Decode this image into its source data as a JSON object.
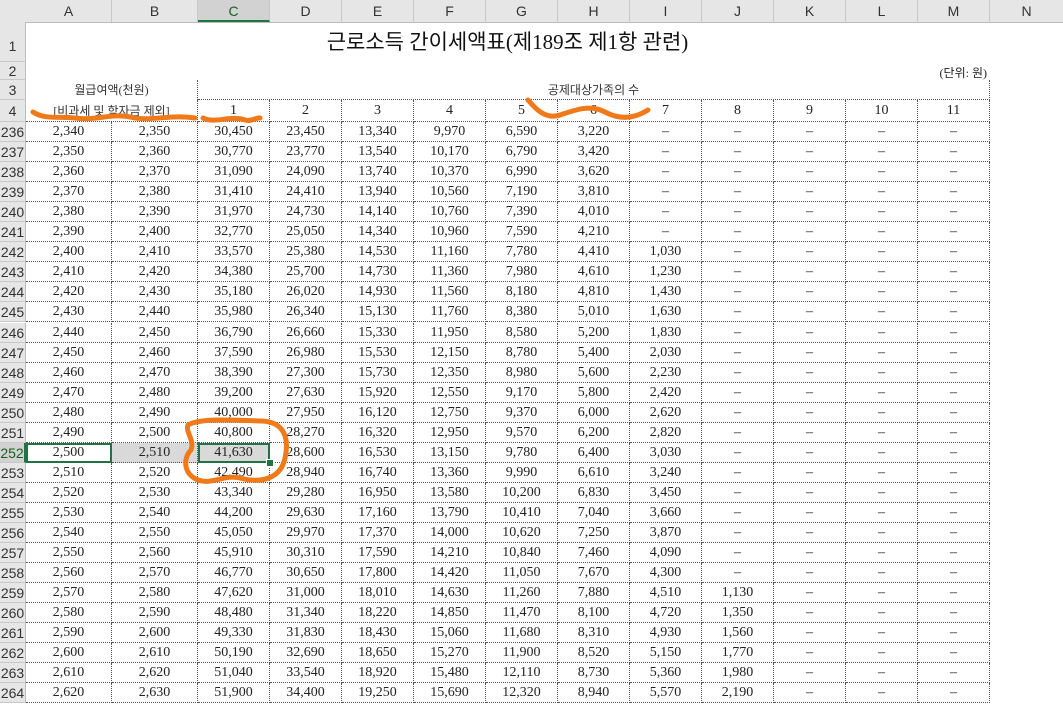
{
  "columns": [
    "A",
    "B",
    "C",
    "D",
    "E",
    "F",
    "G",
    "H",
    "I",
    "J",
    "K",
    "L",
    "M",
    "N"
  ],
  "selected_column": "C",
  "selected_row": "252",
  "sheet": {
    "title": "근로소득 간이세액표(제189조 제1항 관련)",
    "unit": "(단위: 원)",
    "header_salary_line1": "월급여액(천원)",
    "header_salary_line2": "[비과세 및 학자금 제외]",
    "header_family": "공제대상가족의 수",
    "family_counts": [
      "1",
      "2",
      "3",
      "4",
      "5",
      "6",
      "7",
      "8",
      "9",
      "10",
      "11"
    ]
  },
  "header_rows": [
    "1",
    "2",
    "3",
    "4"
  ],
  "rows": [
    {
      "n": "236",
      "cells": [
        "2,340",
        "2,350",
        "30,450",
        "23,450",
        "13,340",
        "9,970",
        "6,590",
        "3,220",
        "–",
        "–",
        "–",
        "–",
        "–"
      ]
    },
    {
      "n": "237",
      "cells": [
        "2,350",
        "2,360",
        "30,770",
        "23,770",
        "13,540",
        "10,170",
        "6,790",
        "3,420",
        "–",
        "–",
        "–",
        "–",
        "–"
      ]
    },
    {
      "n": "238",
      "cells": [
        "2,360",
        "2,370",
        "31,090",
        "24,090",
        "13,740",
        "10,370",
        "6,990",
        "3,620",
        "–",
        "–",
        "–",
        "–",
        "–"
      ]
    },
    {
      "n": "239",
      "cells": [
        "2,370",
        "2,380",
        "31,410",
        "24,410",
        "13,940",
        "10,560",
        "7,190",
        "3,810",
        "–",
        "–",
        "–",
        "–",
        "–"
      ]
    },
    {
      "n": "240",
      "cells": [
        "2,380",
        "2,390",
        "31,970",
        "24,730",
        "14,140",
        "10,760",
        "7,390",
        "4,010",
        "–",
        "–",
        "–",
        "–",
        "–"
      ]
    },
    {
      "n": "241",
      "cells": [
        "2,390",
        "2,400",
        "32,770",
        "25,050",
        "14,340",
        "10,960",
        "7,590",
        "4,210",
        "–",
        "–",
        "–",
        "–",
        "–"
      ]
    },
    {
      "n": "242",
      "cells": [
        "2,400",
        "2,410",
        "33,570",
        "25,380",
        "14,530",
        "11,160",
        "7,780",
        "4,410",
        "1,030",
        "–",
        "–",
        "–",
        "–"
      ]
    },
    {
      "n": "243",
      "cells": [
        "2,410",
        "2,420",
        "34,380",
        "25,700",
        "14,730",
        "11,360",
        "7,980",
        "4,610",
        "1,230",
        "–",
        "–",
        "–",
        "–"
      ]
    },
    {
      "n": "244",
      "cells": [
        "2,420",
        "2,430",
        "35,180",
        "26,020",
        "14,930",
        "11,560",
        "8,180",
        "4,810",
        "1,430",
        "–",
        "–",
        "–",
        "–"
      ]
    },
    {
      "n": "245",
      "cells": [
        "2,430",
        "2,440",
        "35,980",
        "26,340",
        "15,130",
        "11,760",
        "8,380",
        "5,010",
        "1,630",
        "–",
        "–",
        "–",
        "–"
      ]
    },
    {
      "n": "246",
      "cells": [
        "2,440",
        "2,450",
        "36,790",
        "26,660",
        "15,330",
        "11,950",
        "8,580",
        "5,200",
        "1,830",
        "–",
        "–",
        "–",
        "–"
      ]
    },
    {
      "n": "247",
      "cells": [
        "2,450",
        "2,460",
        "37,590",
        "26,980",
        "15,530",
        "12,150",
        "8,780",
        "5,400",
        "2,030",
        "–",
        "–",
        "–",
        "–"
      ]
    },
    {
      "n": "248",
      "cells": [
        "2,460",
        "2,470",
        "38,390",
        "27,300",
        "15,730",
        "12,350",
        "8,980",
        "5,600",
        "2,230",
        "–",
        "–",
        "–",
        "–"
      ]
    },
    {
      "n": "249",
      "cells": [
        "2,470",
        "2,480",
        "39,200",
        "27,630",
        "15,920",
        "12,550",
        "9,170",
        "5,800",
        "2,420",
        "–",
        "–",
        "–",
        "–"
      ]
    },
    {
      "n": "250",
      "cells": [
        "2,480",
        "2,490",
        "40,000",
        "27,950",
        "16,120",
        "12,750",
        "9,370",
        "6,000",
        "2,620",
        "–",
        "–",
        "–",
        "–"
      ]
    },
    {
      "n": "251",
      "cells": [
        "2,490",
        "2,500",
        "40,800",
        "28,270",
        "16,320",
        "12,950",
        "9,570",
        "6,200",
        "2,820",
        "–",
        "–",
        "–",
        "–"
      ]
    },
    {
      "n": "252",
      "cells": [
        "2,500",
        "2,510",
        "41,630",
        "28,600",
        "16,530",
        "13,150",
        "9,780",
        "6,400",
        "3,030",
        "–",
        "–",
        "–",
        "–"
      ]
    },
    {
      "n": "253",
      "cells": [
        "2,510",
        "2,520",
        "42,490",
        "28,940",
        "16,740",
        "13,360",
        "9,990",
        "6,610",
        "3,240",
        "–",
        "–",
        "–",
        "–"
      ]
    },
    {
      "n": "254",
      "cells": [
        "2,520",
        "2,530",
        "43,340",
        "29,280",
        "16,950",
        "13,580",
        "10,200",
        "6,830",
        "3,450",
        "–",
        "–",
        "–",
        "–"
      ]
    },
    {
      "n": "255",
      "cells": [
        "2,530",
        "2,540",
        "44,200",
        "29,630",
        "17,160",
        "13,790",
        "10,410",
        "7,040",
        "3,660",
        "–",
        "–",
        "–",
        "–"
      ]
    },
    {
      "n": "256",
      "cells": [
        "2,540",
        "2,550",
        "45,050",
        "29,970",
        "17,370",
        "14,000",
        "10,620",
        "7,250",
        "3,870",
        "–",
        "–",
        "–",
        "–"
      ]
    },
    {
      "n": "257",
      "cells": [
        "2,550",
        "2,560",
        "45,910",
        "30,310",
        "17,590",
        "14,210",
        "10,840",
        "7,460",
        "4,090",
        "–",
        "–",
        "–",
        "–"
      ]
    },
    {
      "n": "258",
      "cells": [
        "2,560",
        "2,570",
        "46,770",
        "30,650",
        "17,800",
        "14,420",
        "11,050",
        "7,670",
        "4,300",
        "–",
        "–",
        "–",
        "–"
      ]
    },
    {
      "n": "259",
      "cells": [
        "2,570",
        "2,580",
        "47,620",
        "31,000",
        "18,010",
        "14,630",
        "11,260",
        "7,880",
        "4,510",
        "1,130",
        "–",
        "–",
        "–"
      ]
    },
    {
      "n": "260",
      "cells": [
        "2,580",
        "2,590",
        "48,480",
        "31,340",
        "18,220",
        "14,850",
        "11,470",
        "8,100",
        "4,720",
        "1,350",
        "–",
        "–",
        "–"
      ]
    },
    {
      "n": "261",
      "cells": [
        "2,590",
        "2,600",
        "49,330",
        "31,830",
        "18,430",
        "15,060",
        "11,680",
        "8,310",
        "4,930",
        "1,560",
        "–",
        "–",
        "–"
      ]
    },
    {
      "n": "262",
      "cells": [
        "2,600",
        "2,610",
        "50,190",
        "32,690",
        "18,650",
        "15,270",
        "11,900",
        "8,520",
        "5,150",
        "1,770",
        "–",
        "–",
        "–"
      ]
    },
    {
      "n": "263",
      "cells": [
        "2,610",
        "2,620",
        "51,040",
        "33,540",
        "18,920",
        "15,480",
        "12,110",
        "8,730",
        "5,360",
        "1,980",
        "–",
        "–",
        "–"
      ]
    },
    {
      "n": "264",
      "cells": [
        "2,620",
        "2,630",
        "51,900",
        "34,400",
        "19,250",
        "15,690",
        "12,320",
        "8,940",
        "5,570",
        "2,190",
        "–",
        "–",
        "–"
      ]
    }
  ],
  "colors": {
    "annotation": "#f07a1a",
    "selection": "#217346"
  }
}
